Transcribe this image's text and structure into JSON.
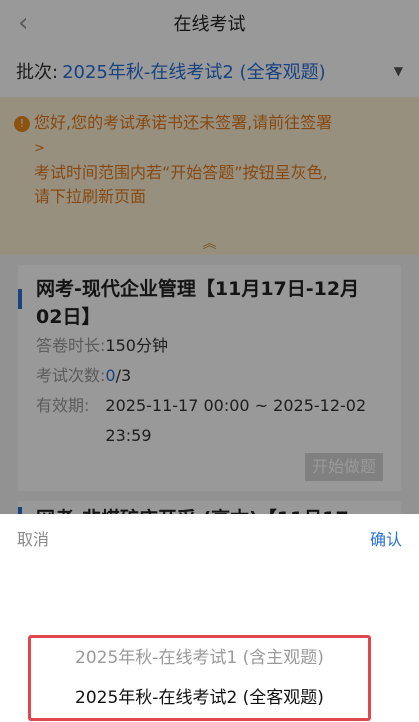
{
  "navbar": {
    "back_icon": "chevron-left",
    "title": "在线考试"
  },
  "batch": {
    "label": "批次:",
    "value": "2025年秋-在线考试2 (全客观题)",
    "arrow": "▼"
  },
  "notice": {
    "line1": "您好,您的考试承诺书还未签署,请前往签署",
    "line1_tail": ">",
    "line2": "考试时间范围内若“开始答题”按钮呈灰色,",
    "line3": "请下拉刷新页面",
    "collapse": "︽"
  },
  "exams": [
    {
      "title": "网考-现代企业管理【11月17日-12月02日】",
      "duration_label": "答卷时长:",
      "duration": "150分钟",
      "attempts_label": "考试次数:",
      "attempts_used": "0",
      "attempts_total": "/3",
      "validity_label": "有效期:",
      "validity": "2025-11-17 00:00 ~ 2025-12-02 23:59",
      "start_button": "开始做题"
    },
    {
      "title": "网考-非煤矿床开采 (高本)【11月17"
    }
  ],
  "picker": {
    "cancel": "取消",
    "confirm": "确认",
    "options": [
      "2025年秋-在线考试1 (含主观题)",
      "2025年秋-在线考试2 (全客观题)"
    ],
    "selected_index": 1
  },
  "colors": {
    "accent": "#2b6fd6",
    "notice_text": "#e07a1f",
    "notice_bg": "#fdf0d2",
    "highlight_border": "#e0474f"
  }
}
